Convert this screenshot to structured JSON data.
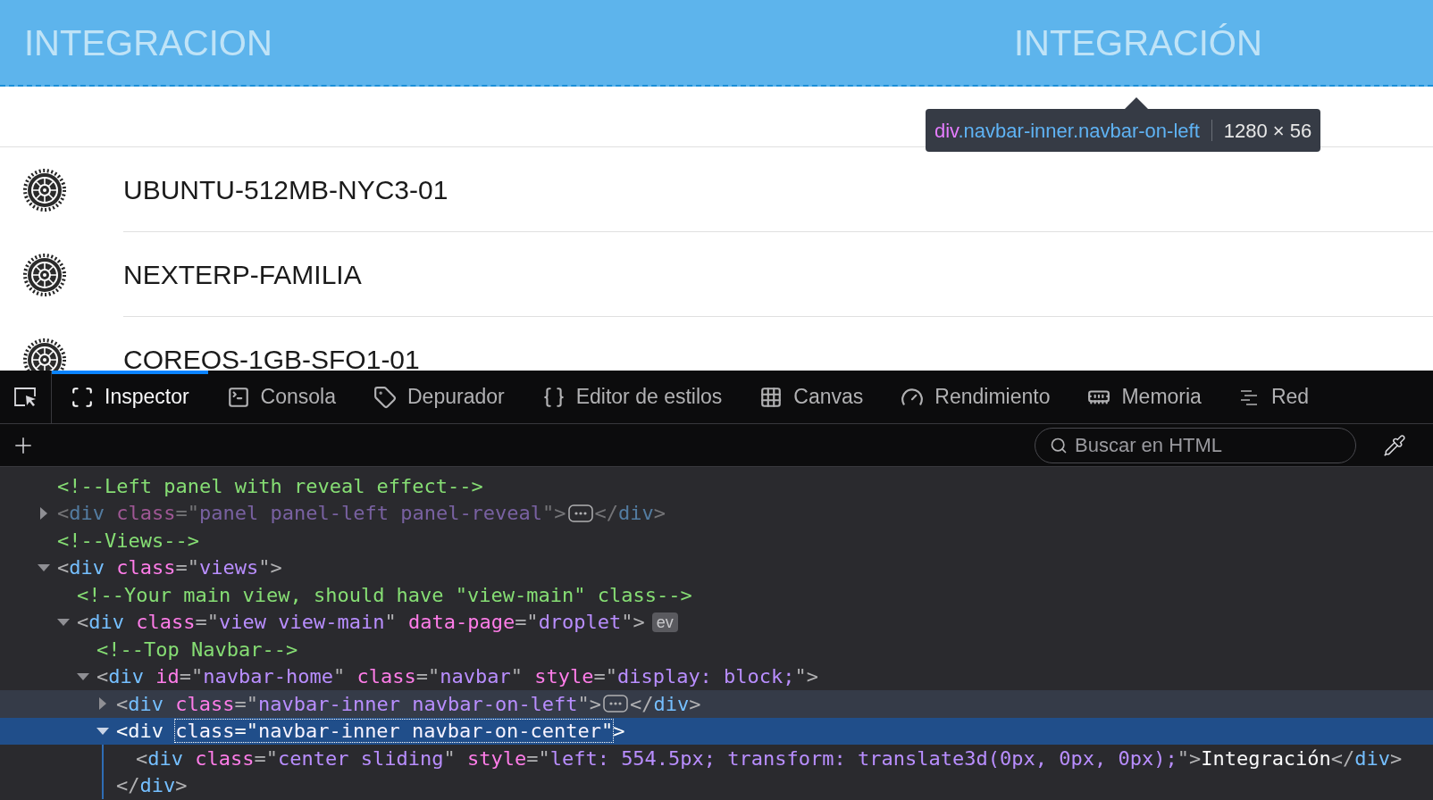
{
  "navbar": {
    "left_title": "INTEGRACION",
    "center_title": "INTEGRACIÓN"
  },
  "tooltip": {
    "selector_tag": "div",
    "selector_classes": ".navbar-inner.navbar-on-left",
    "size": "1280 × 56"
  },
  "list": {
    "items": [
      {
        "label": "UBUNTU-512MB-NYC3-01"
      },
      {
        "label": "NEXTERP-FAMILIA"
      },
      {
        "label": "COREOS-1GB-SFO1-01"
      }
    ]
  },
  "devtools": {
    "tabs": [
      {
        "label": "Inspector",
        "selected": true
      },
      {
        "label": "Consola",
        "selected": false
      },
      {
        "label": "Depurador",
        "selected": false
      },
      {
        "label": "Editor de estilos",
        "selected": false
      },
      {
        "label": "Canvas",
        "selected": false
      },
      {
        "label": "Rendimiento",
        "selected": false
      },
      {
        "label": "Memoria",
        "selected": false
      },
      {
        "label": "Red",
        "selected": false
      }
    ],
    "search": {
      "placeholder": "Buscar en HTML"
    },
    "markup": [
      {
        "kind": "comment",
        "selected": false,
        "hovered": false,
        "dimmed": false,
        "text": "<!--Left panel with reveal effect-->"
      },
      {
        "kind": "element",
        "selected": false,
        "hovered": false,
        "dimmed": true,
        "expanded": false,
        "tokens": [
          {
            "kind": "punct",
            "text": "<"
          },
          {
            "kind": "tag",
            "text": "div"
          },
          {
            "kind": "attr",
            "text": " class"
          },
          {
            "kind": "punct",
            "text": "=\""
          },
          {
            "kind": "value",
            "text": "panel panel-left panel-reveal"
          },
          {
            "kind": "punct",
            "text": "\">"
          }
        ],
        "badge": {
          "kind": "ellipsis"
        },
        "after_tokens": [
          {
            "kind": "punct",
            "text": "</"
          },
          {
            "kind": "tag",
            "text": "div"
          },
          {
            "kind": "punct",
            "text": ">"
          }
        ]
      },
      {
        "kind": "comment",
        "selected": false,
        "hovered": false,
        "dimmed": false,
        "text": "<!--Views-->"
      },
      {
        "kind": "element",
        "selected": false,
        "hovered": false,
        "dimmed": false,
        "expanded": true,
        "tokens": [
          {
            "kind": "punct",
            "text": "<"
          },
          {
            "kind": "tag",
            "text": "div"
          },
          {
            "kind": "attr",
            "text": " class"
          },
          {
            "kind": "punct",
            "text": "=\""
          },
          {
            "kind": "value",
            "text": "views"
          },
          {
            "kind": "punct",
            "text": "\">"
          }
        ],
        "children": [
          {
            "kind": "comment",
            "selected": false,
            "hovered": false,
            "dimmed": false,
            "text": "<!--Your main view, should have \"view-main\" class-->"
          },
          {
            "kind": "element",
            "selected": false,
            "hovered": false,
            "dimmed": false,
            "expanded": true,
            "tokens": [
              {
                "kind": "punct",
                "text": "<"
              },
              {
                "kind": "tag",
                "text": "div"
              },
              {
                "kind": "attr",
                "text": " class"
              },
              {
                "kind": "punct",
                "text": "=\""
              },
              {
                "kind": "value",
                "text": "view view-main"
              },
              {
                "kind": "punct",
                "text": "\""
              },
              {
                "kind": "attr",
                "text": " data-page"
              },
              {
                "kind": "punct",
                "text": "=\""
              },
              {
                "kind": "value",
                "text": "droplet"
              },
              {
                "kind": "punct",
                "text": "\">"
              }
            ],
            "badge": {
              "kind": "event",
              "text": "ev"
            },
            "children": [
              {
                "kind": "comment",
                "selected": false,
                "hovered": false,
                "dimmed": false,
                "text": "<!--Top Navbar-->"
              },
              {
                "kind": "element",
                "selected": false,
                "hovered": false,
                "dimmed": false,
                "expanded": true,
                "tokens": [
                  {
                    "kind": "punct",
                    "text": "<"
                  },
                  {
                    "kind": "tag",
                    "text": "div"
                  },
                  {
                    "kind": "attr",
                    "text": " id"
                  },
                  {
                    "kind": "punct",
                    "text": "=\""
                  },
                  {
                    "kind": "value",
                    "text": "navbar-home"
                  },
                  {
                    "kind": "punct",
                    "text": "\""
                  },
                  {
                    "kind": "attr",
                    "text": " class"
                  },
                  {
                    "kind": "punct",
                    "text": "=\""
                  },
                  {
                    "kind": "value",
                    "text": "navbar"
                  },
                  {
                    "kind": "punct",
                    "text": "\""
                  },
                  {
                    "kind": "attr",
                    "text": " style"
                  },
                  {
                    "kind": "punct",
                    "text": "=\""
                  },
                  {
                    "kind": "value",
                    "text": "display: block;"
                  },
                  {
                    "kind": "punct",
                    "text": "\">"
                  }
                ],
                "children": [
                  {
                    "kind": "element",
                    "selected": false,
                    "hovered": true,
                    "dimmed": false,
                    "expanded": false,
                    "tokens": [
                      {
                        "kind": "punct",
                        "text": "<"
                      },
                      {
                        "kind": "tag",
                        "text": "div"
                      },
                      {
                        "kind": "attr",
                        "text": " class"
                      },
                      {
                        "kind": "punct",
                        "text": "=\""
                      },
                      {
                        "kind": "value",
                        "text": "navbar-inner navbar-on-left"
                      },
                      {
                        "kind": "punct",
                        "text": "\">"
                      }
                    ],
                    "badge": {
                      "kind": "ellipsis"
                    },
                    "after_tokens": [
                      {
                        "kind": "punct",
                        "text": "</"
                      },
                      {
                        "kind": "tag",
                        "text": "div"
                      },
                      {
                        "kind": "punct",
                        "text": ">"
                      }
                    ]
                  },
                  {
                    "kind": "element",
                    "selected": true,
                    "hovered": false,
                    "dimmed": false,
                    "expanded": true,
                    "tokens": [
                      {
                        "kind": "punct",
                        "text": "<"
                      },
                      {
                        "kind": "tag",
                        "text": "div"
                      },
                      {
                        "kind": "group",
                        "focused": true,
                        "tokens": [
                          {
                            "kind": "attr",
                            "text": "class"
                          },
                          {
                            "kind": "punct",
                            "text": "=\""
                          },
                          {
                            "kind": "value",
                            "text": "navbar-inner navbar-on-center"
                          },
                          {
                            "kind": "punct",
                            "text": "\""
                          }
                        ]
                      },
                      {
                        "kind": "punct",
                        "text": ">"
                      }
                    ],
                    "children": [
                      {
                        "kind": "element",
                        "selected": false,
                        "hovered": false,
                        "dimmed": false,
                        "tokens": [
                          {
                            "kind": "punct",
                            "text": "<"
                          },
                          {
                            "kind": "tag",
                            "text": "div"
                          },
                          {
                            "kind": "attr",
                            "text": " class"
                          },
                          {
                            "kind": "punct",
                            "text": "=\""
                          },
                          {
                            "kind": "value",
                            "text": "center sliding"
                          },
                          {
                            "kind": "punct",
                            "text": "\""
                          },
                          {
                            "kind": "attr",
                            "text": " style"
                          },
                          {
                            "kind": "punct",
                            "text": "=\""
                          },
                          {
                            "kind": "value",
                            "text": "left: 554.5px; transform: translate3d(0px, 0px, 0px);"
                          },
                          {
                            "kind": "punct",
                            "text": "\">"
                          },
                          {
                            "kind": "text",
                            "text": "Integración"
                          },
                          {
                            "kind": "punct",
                            "text": "</"
                          },
                          {
                            "kind": "tag",
                            "text": "div"
                          },
                          {
                            "kind": "punct",
                            "text": ">"
                          }
                        ]
                      }
                    ],
                    "closing_tokens": [
                      {
                        "kind": "punct",
                        "text": "</"
                      },
                      {
                        "kind": "tag",
                        "text": "div"
                      },
                      {
                        "kind": "punct",
                        "text": ">"
                      }
                    ]
                  }
                ]
              }
            ]
          }
        ]
      }
    ]
  }
}
